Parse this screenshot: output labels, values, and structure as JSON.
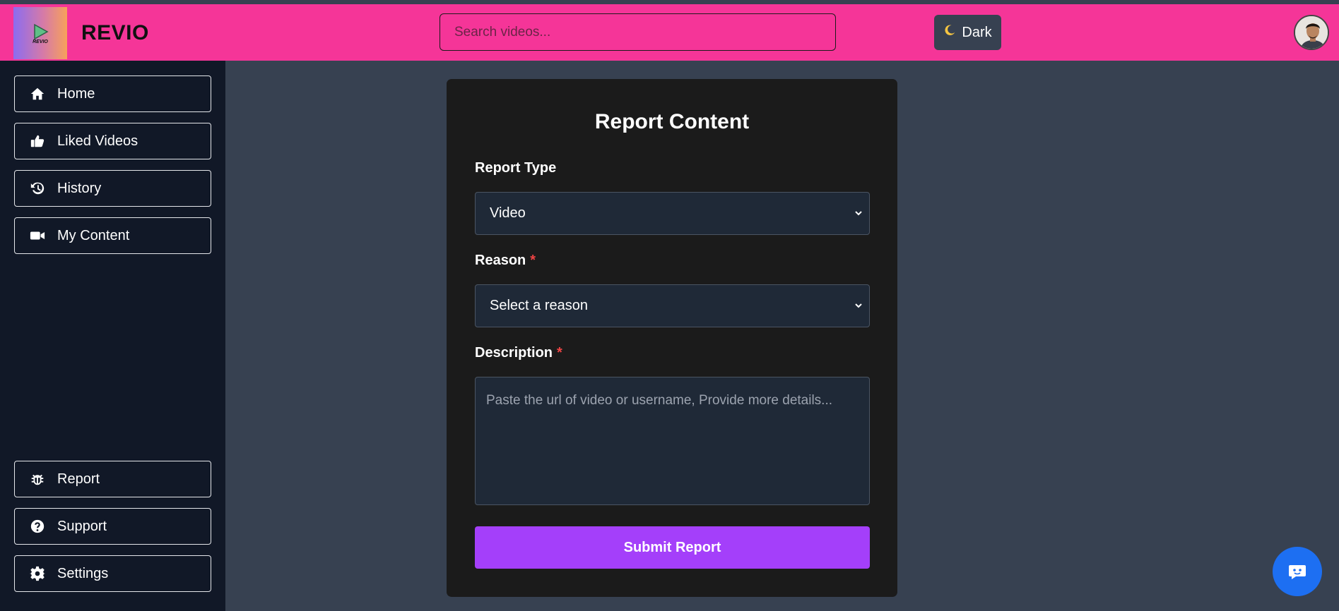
{
  "app": {
    "brand": "REVIO",
    "logo_small_text": "REVIO"
  },
  "header": {
    "search_placeholder": "Search videos...",
    "theme_label": "Dark",
    "theme_icon": "moon-icon"
  },
  "sidebar": {
    "top_items": [
      {
        "label": "Home",
        "icon": "home-icon"
      },
      {
        "label": "Liked Videos",
        "icon": "thumbs-up-icon"
      },
      {
        "label": "History",
        "icon": "history-icon"
      },
      {
        "label": "My Content",
        "icon": "video-camera-icon"
      }
    ],
    "bottom_items": [
      {
        "label": "Report",
        "icon": "bug-icon"
      },
      {
        "label": "Support",
        "icon": "question-circle-icon"
      },
      {
        "label": "Settings",
        "icon": "gear-icon"
      }
    ]
  },
  "form": {
    "title": "Report Content",
    "report_type_label": "Report Type",
    "report_type_value": "Video",
    "reason_label": "Reason",
    "reason_value": "Select a reason",
    "required_mark": "*",
    "description_label": "Description",
    "description_placeholder": "Paste the url of video or username, Provide more details...",
    "submit_label": "Submit Report"
  },
  "colors": {
    "header": "#f53598",
    "sidebar": "#111827",
    "content_bg": "#374151",
    "card": "#1b1b1b",
    "accent": "#a43ffa",
    "chat": "#1d6ff2",
    "required": "#ef4444"
  }
}
